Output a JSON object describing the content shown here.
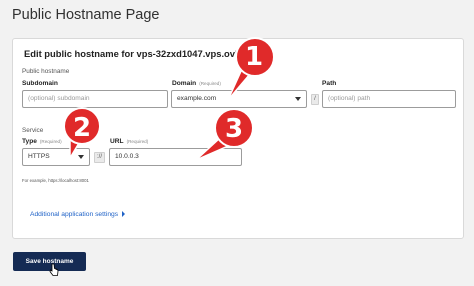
{
  "page": {
    "title": "Public Hostname Page"
  },
  "form": {
    "heading": "Edit public hostname for vps-32zxd1047.vps.ovh.net",
    "public_hostname_section": "Public hostname",
    "subdomain": {
      "label": "Subdomain",
      "placeholder": "(optional) subdomain",
      "value": ""
    },
    "domain": {
      "label": "Domain",
      "required": "(Required)",
      "value": "example.com"
    },
    "path": {
      "label": "Path",
      "placeholder": "(optional) path",
      "value": ""
    },
    "dot_separator": ".",
    "slash_separator": "/",
    "service_section": "Service",
    "type": {
      "label": "Type",
      "required": "(Required)",
      "value": "HTTPS"
    },
    "scheme_separator": "://",
    "url": {
      "label": "URL",
      "required": "(Required)",
      "value": "10.0.0.3"
    },
    "example_text": "For example, https://localhost:8001",
    "additional_settings_label": "Additional application settings"
  },
  "footer": {
    "save_label": "Save hostname"
  },
  "callouts": [
    "1",
    "2",
    "3"
  ],
  "colors": {
    "callout_red": "#e02a2a",
    "save_button": "#152b54",
    "link_blue": "#1f62c7"
  }
}
